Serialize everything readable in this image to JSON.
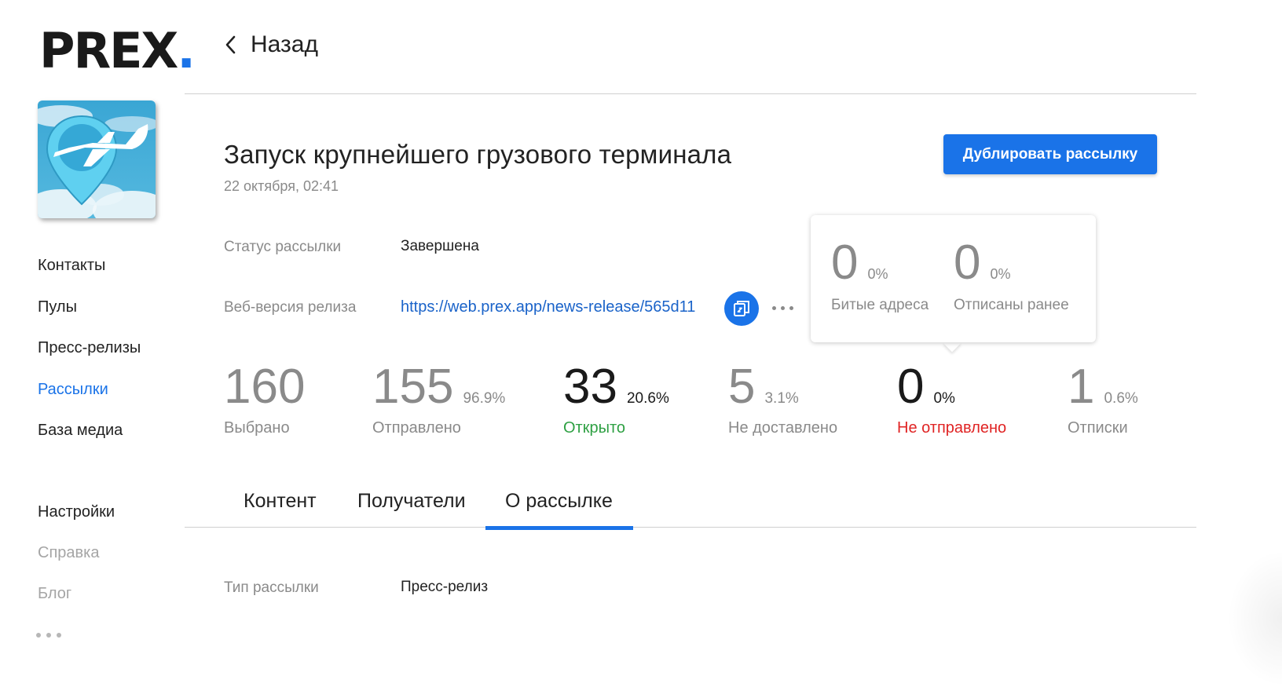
{
  "logo": {
    "text": "PREX",
    "dot": "."
  },
  "sidebar": {
    "items": [
      {
        "label": "Контакты"
      },
      {
        "label": "Пулы"
      },
      {
        "label": "Пресс-релизы"
      },
      {
        "label": "Рассылки"
      },
      {
        "label": "База медиа"
      },
      {
        "label": "Настройки"
      },
      {
        "label": "Справка"
      },
      {
        "label": "Блог"
      }
    ],
    "active": "Рассылки"
  },
  "header": {
    "back_label": "Назад"
  },
  "mailing": {
    "title": "Запуск крупнейшего грузового терминала",
    "date": "22 октября, 02:41",
    "duplicate_label": "Дублировать рассылку",
    "status_label": "Статус рассылки",
    "status_value": "Завершена",
    "web_label": "Веб-версия релиза",
    "web_url": "https://web.prex.app/news-release/565d11"
  },
  "popover": {
    "stats": [
      {
        "value": "0",
        "pct": "0%",
        "label": "Битые адреса"
      },
      {
        "value": "0",
        "pct": "0%",
        "label": "Отписаны ранее"
      }
    ]
  },
  "stats": [
    {
      "value": "160",
      "pct": "",
      "label": "Выбрано"
    },
    {
      "value": "155",
      "pct": "96.9%",
      "label": "Отправлено"
    },
    {
      "value": "33",
      "pct": "20.6%",
      "label": "Открыто"
    },
    {
      "value": "5",
      "pct": "3.1%",
      "label": "Не доставлено"
    },
    {
      "value": "0",
      "pct": "0%",
      "label": "Не отправлено"
    },
    {
      "value": "1",
      "pct": "0.6%",
      "label": "Отписки"
    }
  ],
  "tabs": [
    {
      "label": "Контент"
    },
    {
      "label": "Получатели"
    },
    {
      "label": "О рассылке"
    }
  ],
  "active_tab": "О рассылке",
  "details": {
    "type_label": "Тип рассылки",
    "type_value": "Пресс-релиз"
  },
  "colors": {
    "accent": "#1a73e8",
    "link": "#1a63c9",
    "opened": "#2ea043",
    "not_sent": "#e02424",
    "muted": "#8a8a8a"
  }
}
